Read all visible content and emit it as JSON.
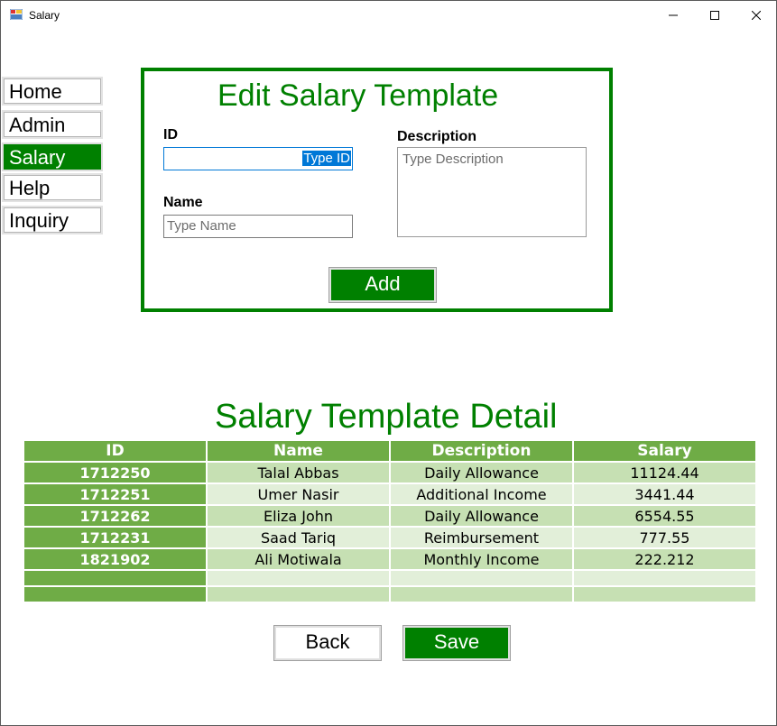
{
  "window": {
    "title": "Salary"
  },
  "nav": {
    "items": [
      {
        "label": "Home"
      },
      {
        "label": "Admin"
      },
      {
        "label": "Salary"
      },
      {
        "label": "Help"
      },
      {
        "label": "Inquiry"
      }
    ],
    "active": "Salary"
  },
  "edit": {
    "title": "Edit Salary Template",
    "id_label": "ID",
    "id_placeholder": "Type ID",
    "name_label": "Name",
    "name_placeholder": "Type Name",
    "description_label": "Description",
    "description_placeholder": "Type Description",
    "add_label": "Add"
  },
  "detail": {
    "title": "Salary Template Detail",
    "columns": [
      "ID",
      "Name",
      "Description",
      "Salary"
    ],
    "rows": [
      {
        "id": "1712250",
        "name": "Talal Abbas",
        "description": "Daily Allowance",
        "salary": "11124.44"
      },
      {
        "id": "1712251",
        "name": "Umer Nasir",
        "description": "Additional Income",
        "salary": "3441.44"
      },
      {
        "id": "1712262",
        "name": "Eliza John",
        "description": "Daily Allowance",
        "salary": "6554.55"
      },
      {
        "id": "1712231",
        "name": "Saad Tariq",
        "description": "Reimbursement",
        "salary": "777.55"
      },
      {
        "id": "1821902",
        "name": "Ali Motiwala",
        "description": "Monthly Income",
        "salary": "222.212"
      }
    ]
  },
  "footer": {
    "back_label": "Back",
    "save_label": "Save"
  },
  "colors": {
    "accent": "#008000",
    "table_header": "#6fac46",
    "row_dark": "#c6e0b3",
    "row_light": "#e2efd9"
  }
}
